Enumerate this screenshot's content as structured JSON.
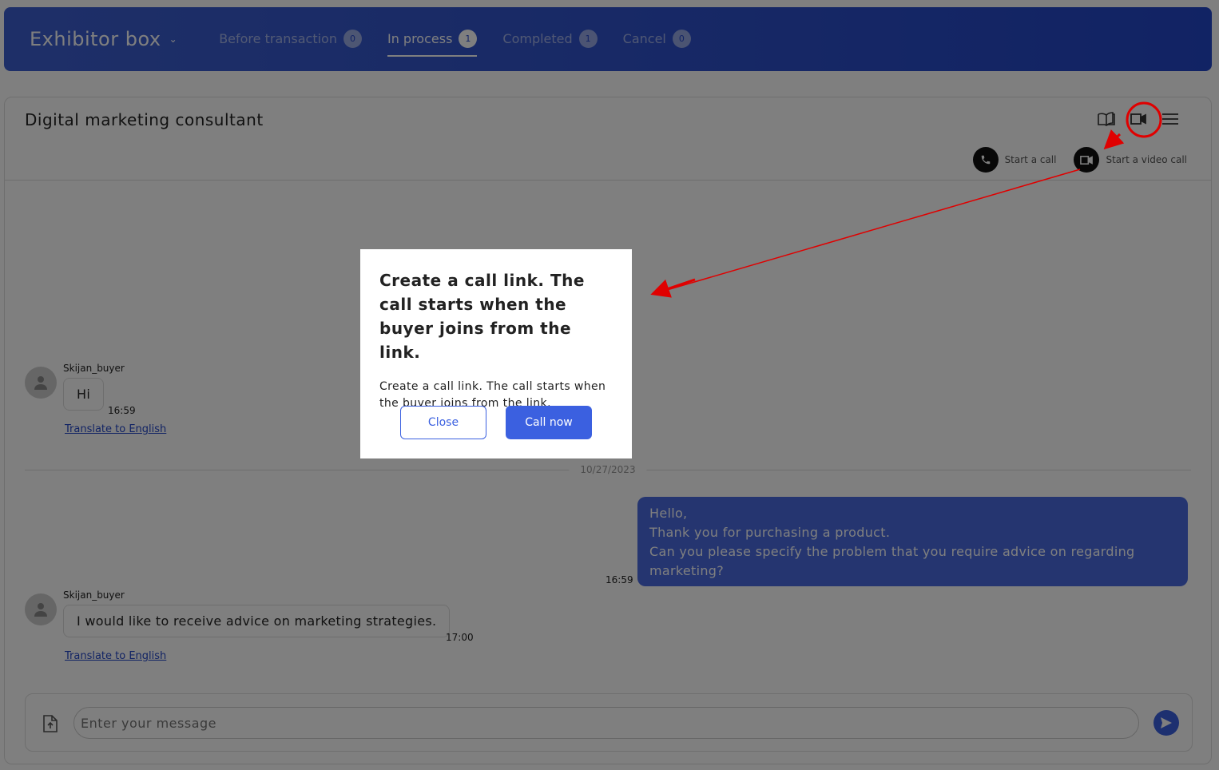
{
  "header": {
    "brand": "Exhibitor box",
    "tabs": [
      {
        "label": "Before transaction",
        "count": "0"
      },
      {
        "label": "In process",
        "count": "1",
        "active": true
      },
      {
        "label": "Completed",
        "count": "1"
      },
      {
        "label": "Cancel",
        "count": "0"
      }
    ]
  },
  "chat": {
    "title": "Digital marketing consultant",
    "toolbar_icons": [
      "book-icon",
      "video-camera-icon",
      "menu-icon"
    ],
    "start_call": "Start a call",
    "start_video_call": "Start a video call",
    "messages": [
      {
        "sender": "Skijan_buyer",
        "text": "Hi",
        "time": "16:59",
        "translate": "Translate to English"
      },
      {
        "date": "10/27/2023"
      },
      {
        "outgoing": true,
        "lines": [
          "Hello,",
          "Thank you for purchasing a product.",
          "Can you please specify the problem that you require advice on regarding marketing?"
        ],
        "time": "16:59"
      },
      {
        "sender": "Skijan_buyer",
        "text": "I would like to receive advice on marketing strategies.",
        "time": "17:00",
        "translate": "Translate to English"
      }
    ],
    "input_placeholder": "Enter your message"
  },
  "modal": {
    "heading": "Create a call link. The call starts when the buyer joins from the link.",
    "body": "Create a call link. The call starts when the buyer joins from the link.",
    "close": "Close",
    "call_now": "Call now"
  },
  "colors": {
    "accent": "#3b60e0",
    "annotation": "#e00000"
  }
}
